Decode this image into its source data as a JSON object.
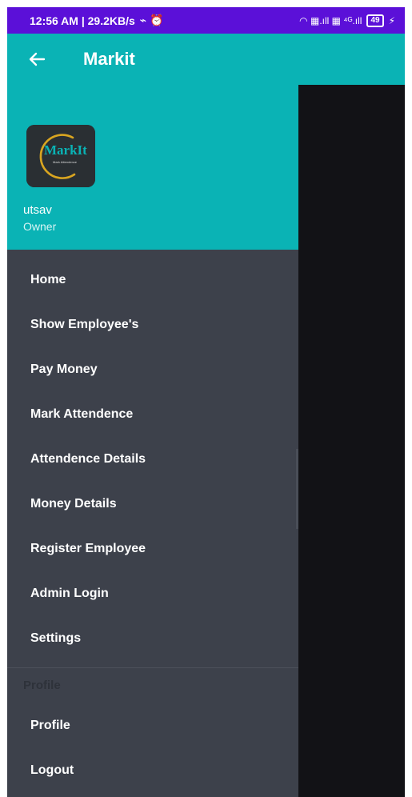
{
  "status_bar": {
    "time_speed": "12:56 AM | 29.2KB/s",
    "indicators": "⌁ ⏰",
    "right_icons": "◠ ▦.ıll ▦ ⁴ᴳ.ıll",
    "battery": "49",
    "charging": "⚡"
  },
  "app_bar": {
    "title": "Markit",
    "back_icon": "arrow-left-icon"
  },
  "drawer": {
    "header": {
      "logo_title": "MarkIt",
      "logo_subtitle": "Mark Attendence",
      "user_name": "utsav",
      "user_role": "Owner"
    },
    "items": [
      {
        "label": "Home"
      },
      {
        "label": "Show Employee's"
      },
      {
        "label": "Pay Money"
      },
      {
        "label": "Mark Attendence"
      },
      {
        "label": "Attendence Details"
      },
      {
        "label": "Money Details"
      },
      {
        "label": "Register Employee"
      },
      {
        "label": "Admin Login"
      },
      {
        "label": "Settings"
      }
    ],
    "section_label": "Profile",
    "profile_items": [
      {
        "label": "Profile"
      },
      {
        "label": "Logout"
      }
    ]
  },
  "colors": {
    "status_bar": "#5b10d8",
    "accent": "#0ab3b5",
    "drawer_bg": "#3d414b",
    "scrim": "#121216",
    "logo_gold": "#d9a520"
  }
}
